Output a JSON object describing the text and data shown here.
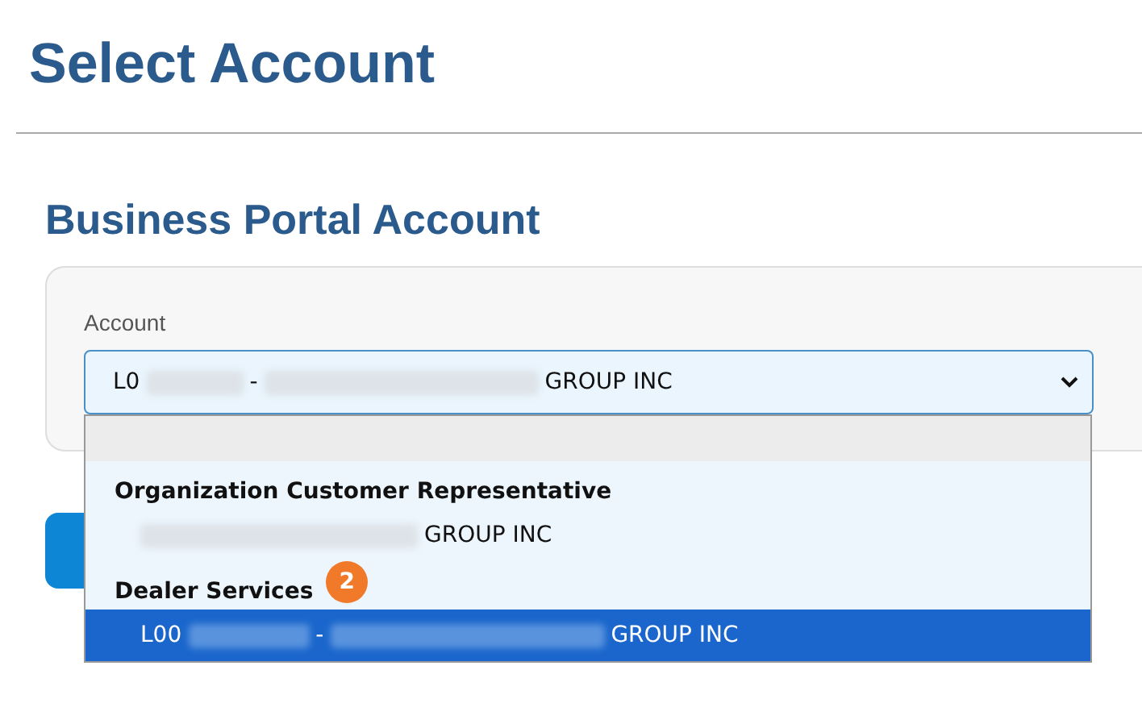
{
  "page_title": "Select Account",
  "section_title": "Business Portal Account",
  "account_field": {
    "label": "Account",
    "value": [
      {
        "kind": "text",
        "text": "L0"
      },
      {
        "kind": "redacted"
      },
      {
        "kind": "text",
        "text": "-"
      },
      {
        "kind": "redacted"
      },
      {
        "kind": "text",
        "text": "GROUP INC"
      }
    ],
    "expanded": true
  },
  "dropdown": {
    "blank_option": true,
    "groups": [
      {
        "label": "Organization Customer Representative",
        "options": [
          {
            "value": [
              {
                "kind": "redacted"
              },
              {
                "kind": "text",
                "text": "GROUP INC"
              }
            ],
            "selected": false
          }
        ]
      },
      {
        "label": "Dealer Services",
        "badge": "2",
        "options": [
          {
            "value": [
              {
                "kind": "text",
                "text": "L00"
              },
              {
                "kind": "redacted"
              },
              {
                "kind": "text",
                "text": "-"
              },
              {
                "kind": "redacted"
              },
              {
                "kind": "text",
                "text": "GROUP INC"
              }
            ],
            "selected": true
          }
        ]
      }
    ]
  }
}
